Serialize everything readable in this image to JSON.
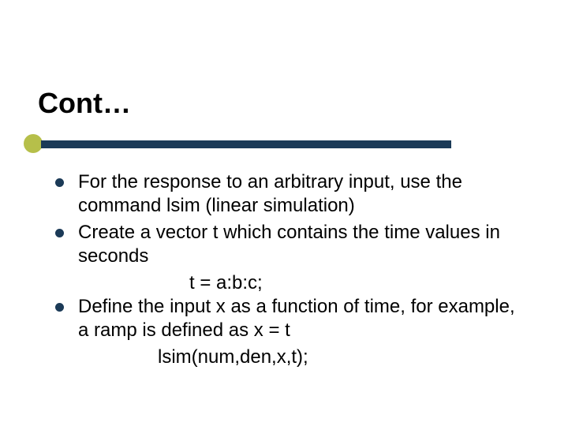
{
  "title": "Cont…",
  "bullets": [
    {
      "text": "For the response to an arbitrary input, use the command lsim (linear simulation)"
    },
    {
      "text": "Create a vector t which contains the time values in seconds",
      "sub": "t = a:b:c;"
    },
    {
      "text": "Define the input x as a function of time, for example, a ramp is defined as x = t",
      "sub": "lsim(num,den,x,t);"
    }
  ],
  "colors": {
    "accent": "#b6bf4a",
    "bar": "#1b3a57"
  }
}
